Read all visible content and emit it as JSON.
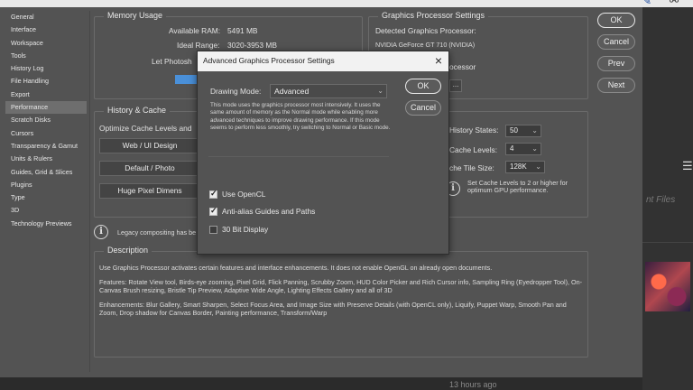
{
  "colors": {
    "panel": "#535353",
    "dialog_titlebar": "#f2f2f2",
    "gpu_bar": "#4a90d9"
  },
  "sidebar": {
    "items": [
      {
        "label": "General"
      },
      {
        "label": "Interface"
      },
      {
        "label": "Workspace"
      },
      {
        "label": "Tools"
      },
      {
        "label": "History Log"
      },
      {
        "label": "File Handling"
      },
      {
        "label": "Export"
      },
      {
        "label": "Performance"
      },
      {
        "label": "Scratch Disks"
      },
      {
        "label": "Cursors"
      },
      {
        "label": "Transparency & Gamut"
      },
      {
        "label": "Units & Rulers"
      },
      {
        "label": "Guides, Grid & Slices"
      },
      {
        "label": "Plugins"
      },
      {
        "label": "Type"
      },
      {
        "label": "3D"
      },
      {
        "label": "Technology Previews"
      }
    ],
    "active": "Performance"
  },
  "memory": {
    "title": "Memory Usage",
    "available_label": "Available RAM:",
    "available_value": "5491 MB",
    "ideal_label": "Ideal Range:",
    "ideal_value": "3020-3953 MB",
    "let_label": "Let Photosh",
    "usage_fraction": 0.7
  },
  "gpu": {
    "title": "Graphics Processor Settings",
    "detected_label": "Detected Graphics Processor:",
    "detected_value": "NVIDIA GeForce GT 710 (NVIDIA)",
    "partial_label": "ocessor",
    "button_label": "..."
  },
  "history": {
    "title": "History & Cache",
    "optimize_label": "Optimize Cache Levels and",
    "btn_web": "Web / UI Design",
    "btn_default": "Default / Photo",
    "btn_pixel": "Huge Pixel Dimens",
    "states_label": "History States:",
    "states_value": "50",
    "cache_label": "Cache Levels:",
    "cache_value": "4",
    "tile_label": "che Tile Size:",
    "tile_value": "128K",
    "gpu_note": "Set Cache Levels to 2 or higher for optimum GPU performance."
  },
  "legacy": {
    "text": "Legacy compositing has be"
  },
  "description": {
    "title": "Description",
    "p1": "Use Graphics Processor activates certain features and interface enhancements. It does not enable OpenGL on already open documents.",
    "p2": "Features: Rotate View tool, Birds-eye zooming, Pixel Grid, Flick Panning, Scrubby Zoom, HUD Color Picker and Rich Cursor info, Sampling Ring (Eyedropper Tool), On-Canvas Brush resizing, Bristle Tip Preview, Adaptive Wide Angle, Lighting Effects Gallery and all of 3D",
    "p3": "Enhancements: Blur Gallery, Smart Sharpen, Select Focus Area, and Image Size with Preserve Details (with OpenCL only), Liquify, Puppet Warp, Smooth Pan and Zoom, Drop shadow for Canvas Border, Painting performance, Transform/Warp"
  },
  "side_buttons": {
    "ok": "OK",
    "cancel": "Cancel",
    "prev": "Prev",
    "next": "Next"
  },
  "dialog": {
    "title": "Advanced Graphics Processor Settings",
    "close": "×",
    "drawing_mode_label": "Drawing Mode:",
    "drawing_mode_value": "Advanced",
    "mode_description": "This mode uses the graphics processor most intensively. It uses the same amount of memory as the Normal mode while enabling more advanced techniques to improve drawing performance. If this mode seems to perform less smoothly, try switching to Normal or Basic mode.",
    "ok": "OK",
    "cancel": "Cancel",
    "options": [
      {
        "label": "Use OpenCL",
        "checked": true
      },
      {
        "label": "Anti-alias Guides and Paths",
        "checked": true
      },
      {
        "label": "30 Bit Display",
        "checked": false
      }
    ]
  },
  "background": {
    "ghost_text": "nt Files",
    "timestamp": "13 hours ago"
  }
}
